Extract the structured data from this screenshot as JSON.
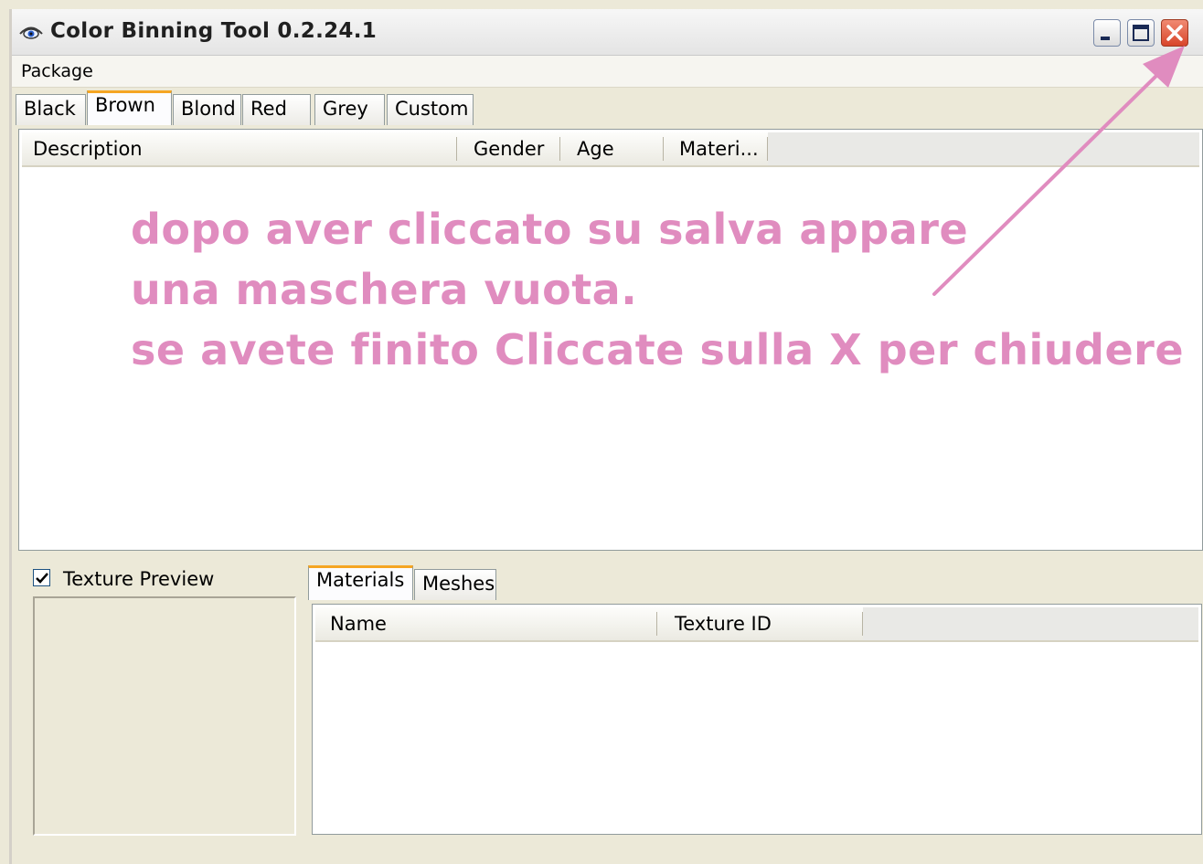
{
  "window": {
    "title": "Color Binning Tool 0.2.24.1",
    "icon": "eye-icon",
    "controls": [
      "minimize-icon",
      "maximize-icon",
      "close-icon"
    ]
  },
  "menu": {
    "items": [
      "Package"
    ]
  },
  "top_tabs": {
    "items": [
      "Black",
      "Brown",
      "Blond",
      "Red",
      "Grey",
      "Custom"
    ],
    "active": "Brown"
  },
  "top_grid": {
    "columns": [
      "Description",
      "Gender",
      "Age",
      "Materi..."
    ],
    "rows": []
  },
  "annotation": {
    "lines": [
      "dopo aver cliccato su salva appare",
      "una maschera vuota.",
      "se avete finito Cliccate sulla X per chiudere"
    ],
    "color": "#e08cbf"
  },
  "texture_preview": {
    "label": "Texture Preview",
    "checked": true
  },
  "bottom_tabs": {
    "items": [
      "Materials",
      "Meshes"
    ],
    "active": "Materials"
  },
  "bottom_grid": {
    "columns": [
      "Name",
      "Texture ID"
    ],
    "rows": []
  },
  "colors": {
    "window_bg": "#ece9d8",
    "tab_accent": "#f5a623",
    "close_button": "#d8452a",
    "arrow": "#e08cbf"
  }
}
